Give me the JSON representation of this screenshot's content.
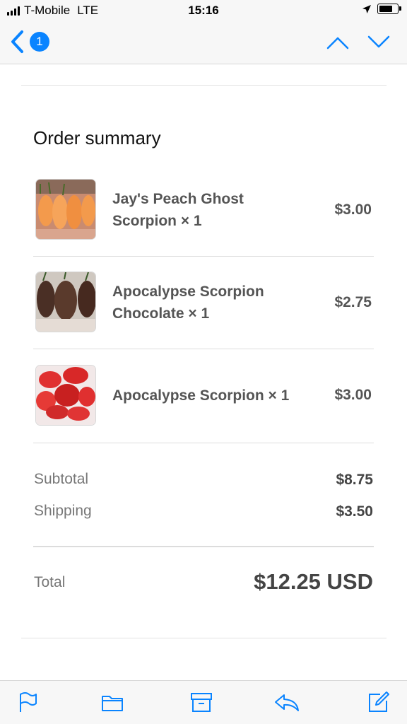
{
  "status_bar": {
    "carrier": "T-Mobile",
    "network": "LTE",
    "time": "15:16",
    "battery_level": 0.8
  },
  "nav": {
    "back_icon": "chevron-left-icon",
    "unread_count": "1",
    "prev_icon": "chevron-up-icon",
    "next_icon": "chevron-down-icon"
  },
  "order": {
    "title": "Order summary",
    "items": [
      {
        "name_line1": "Jay's Peach Ghost",
        "name_line2": "Scorpion × 1",
        "price": "$3.00"
      },
      {
        "name_line1": "Apocalypse Scorpion",
        "name_line2": "Chocolate × 1",
        "price": "$2.75"
      },
      {
        "name_line1": "Apocalypse Scorpion × 1",
        "name_line2": "",
        "price": "$3.00"
      }
    ],
    "subtotal_label": "Subtotal",
    "subtotal_value": "$8.75",
    "shipping_label": "Shipping",
    "shipping_value": "$3.50",
    "total_label": "Total",
    "total_value": "$12.25 USD"
  },
  "toolbar": {
    "icons": [
      "flag-icon",
      "folder-icon",
      "archive-icon",
      "reply-icon",
      "compose-icon"
    ]
  },
  "colors": {
    "accent": "#0a84ff",
    "bar_background": "#f7f7f7"
  }
}
